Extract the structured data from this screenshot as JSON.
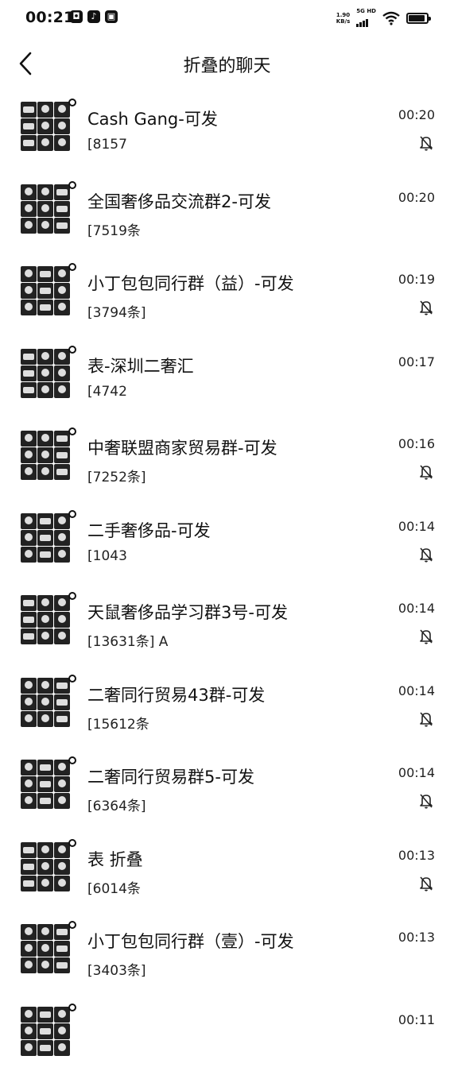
{
  "status_bar": {
    "time": "00:21",
    "app_icons": [
      "◘",
      "♪",
      "▣"
    ],
    "net_speed_value": "1.90",
    "net_speed_unit": "KB/s",
    "signal_tag": "5G HD",
    "battery_level": 0.9
  },
  "header": {
    "title": "折叠的聊天"
  },
  "chats": [
    {
      "name": "Cash Gang-可发",
      "preview": "[8157",
      "time": "00:20",
      "muted": true
    },
    {
      "name": "全国奢侈品交流群2-可发",
      "preview": "[7519条",
      "time": "00:20",
      "muted": false
    },
    {
      "name": "小丁包包同行群（益）-可发",
      "preview": "[3794条]",
      "time": "00:19",
      "muted": true
    },
    {
      "name": "表-深圳二奢汇",
      "preview": "[4742",
      "time": "00:17",
      "muted": false
    },
    {
      "name": "中奢联盟商家贸易群-可发",
      "preview": "[7252条]",
      "time": "00:16",
      "muted": true
    },
    {
      "name": "二手奢侈品-可发",
      "preview": "[1043",
      "time": "00:14",
      "muted": true
    },
    {
      "name": "天鼠奢侈品学习群3号-可发",
      "preview": "[13631条] A",
      "time": "00:14",
      "muted": true
    },
    {
      "name": "二奢同行贸易43群-可发",
      "preview": "[15612条",
      "time": "00:14",
      "muted": true
    },
    {
      "name": "二奢同行贸易群5-可发",
      "preview": "[6364条]",
      "time": "00:14",
      "muted": true
    },
    {
      "name": "表 折叠",
      "preview": "[6014条",
      "time": "00:13",
      "muted": true
    },
    {
      "name": "小丁包包同行群（壹）-可发",
      "preview": "[3403条]",
      "time": "00:13",
      "muted": false
    },
    {
      "name": "",
      "preview": "",
      "time": "00:11",
      "muted": false
    }
  ],
  "colors": {
    "background": "#ffffff",
    "text": "#111111",
    "icon": "#222222"
  }
}
